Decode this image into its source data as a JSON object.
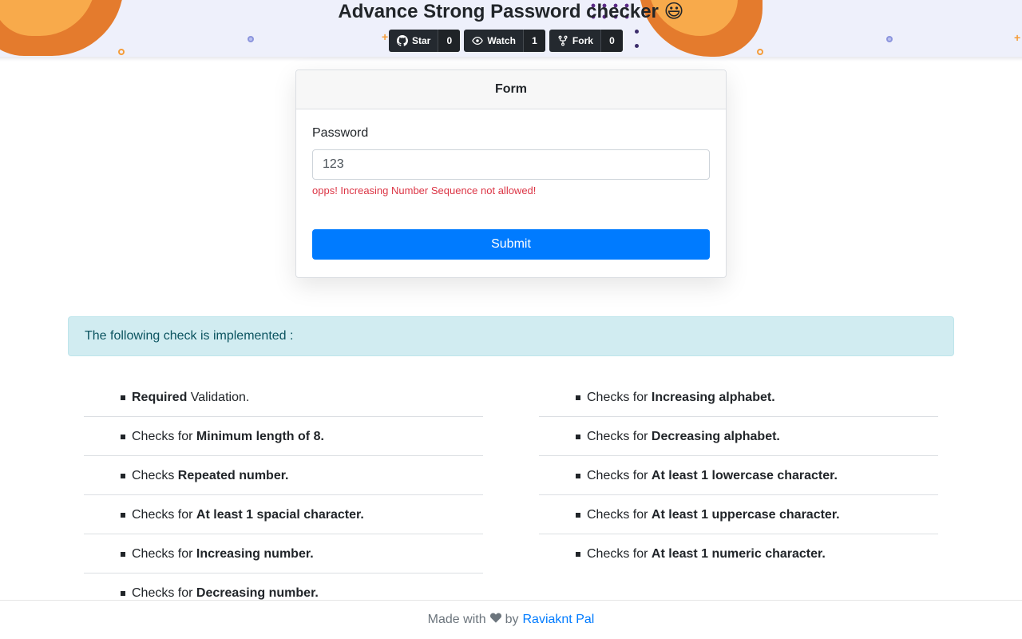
{
  "header": {
    "title": "Advance Strong Password checker 😃",
    "github_buttons": [
      {
        "label": "Star",
        "count": "0",
        "icon": "github-icon"
      },
      {
        "label": "Watch",
        "count": "1",
        "icon": "eye-icon"
      },
      {
        "label": "Fork",
        "count": "0",
        "icon": "fork-icon"
      }
    ]
  },
  "form": {
    "heading": "Form",
    "password_label": "Password",
    "password_value": "123",
    "error_message": "opps! Increasing Number Sequence not allowed!",
    "submit_label": "Submit"
  },
  "alert": {
    "text": "The following check is implemented :"
  },
  "checks": {
    "left": [
      {
        "prefix": "",
        "bold": "Required",
        "suffix": " Validation."
      },
      {
        "prefix": "Checks for ",
        "bold": "Minimum length of 8.",
        "suffix": ""
      },
      {
        "prefix": "Checks ",
        "bold": "Repeated number.",
        "suffix": ""
      },
      {
        "prefix": "Checks for ",
        "bold": "At least 1 spacial character.",
        "suffix": ""
      },
      {
        "prefix": "Checks for ",
        "bold": "Increasing number.",
        "suffix": ""
      },
      {
        "prefix": "Checks for ",
        "bold": "Decreasing number.",
        "suffix": ""
      }
    ],
    "right": [
      {
        "prefix": "Checks for ",
        "bold": "Increasing alphabet.",
        "suffix": ""
      },
      {
        "prefix": "Checks for ",
        "bold": "Decreasing alphabet.",
        "suffix": ""
      },
      {
        "prefix": "Checks for ",
        "bold": "At least 1 lowercase character.",
        "suffix": ""
      },
      {
        "prefix": "Checks for ",
        "bold": "At least 1 uppercase character.",
        "suffix": ""
      },
      {
        "prefix": "Checks for ",
        "bold": "At least 1 numeric character.",
        "suffix": ""
      }
    ]
  },
  "footer": {
    "made_with": "Made with",
    "heart_icon": "heart-icon",
    "by": "by",
    "author": "Raviaknt Pal"
  },
  "colors": {
    "accent": "#007bff",
    "error": "#dc3545",
    "alert_bg": "#d1ecf1",
    "alert_text": "#0c5460",
    "header_bg": "#eef0fb",
    "deco_orange": "#e47b2d",
    "deco_light_orange": "#f8aa4b",
    "github_dark": "#24292f"
  }
}
